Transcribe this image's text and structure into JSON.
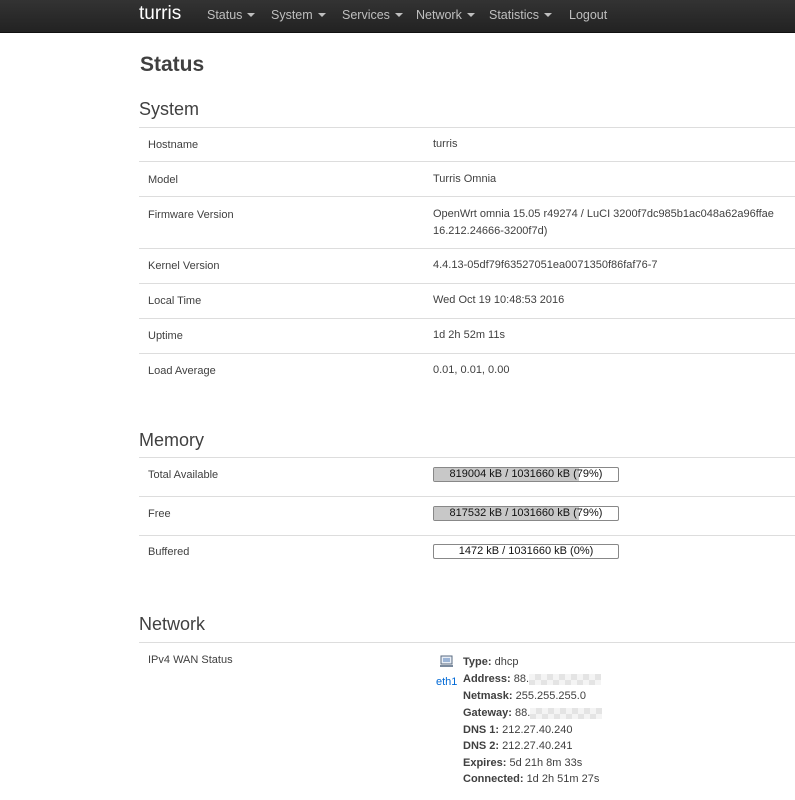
{
  "navbar": {
    "brand": "turris",
    "items": [
      {
        "label": "Status",
        "dropdown": true
      },
      {
        "label": "System",
        "dropdown": true
      },
      {
        "label": "Services",
        "dropdown": true
      },
      {
        "label": "Network",
        "dropdown": true
      },
      {
        "label": "Statistics",
        "dropdown": true
      },
      {
        "label": "Logout",
        "dropdown": false
      }
    ]
  },
  "page": {
    "title": "Status"
  },
  "system": {
    "heading": "System",
    "rows": [
      {
        "label": "Hostname",
        "value": "turris"
      },
      {
        "label": "Model",
        "value": "Turris Omnia"
      },
      {
        "label": "Firmware Version",
        "value": "OpenWrt omnia 15.05 r49274 / LuCI 3200f7dc985b1ac048a62a96ffae",
        "value2": "16.212.24666-3200f7d)"
      },
      {
        "label": "Kernel Version",
        "value": "4.4.13-05df79f63527051ea0071350f86faf76-7"
      },
      {
        "label": "Local Time",
        "value": "Wed Oct 19 10:48:53 2016"
      },
      {
        "label": "Uptime",
        "value": "1d 2h 52m 11s"
      },
      {
        "label": "Load Average",
        "value": "0.01, 0.01, 0.00"
      }
    ]
  },
  "memory": {
    "heading": "Memory",
    "rows": [
      {
        "label": "Total Available",
        "text": "819004 kB / 1031660 kB (79%)",
        "fraction": 0.79
      },
      {
        "label": "Free",
        "text": "817532 kB / 1031660 kB (79%)",
        "fraction": 0.79
      },
      {
        "label": "Buffered",
        "text": "1472 kB / 1031660 kB (0%)",
        "fraction": 0.0
      }
    ]
  },
  "network": {
    "heading": "Network",
    "wan_label": "IPv4 WAN Status",
    "icon": "network-port-icon",
    "interface": "eth1",
    "details": [
      {
        "key": "Type:",
        "value": "dhcp"
      },
      {
        "key": "Address:",
        "value": "88.",
        "redacted": true
      },
      {
        "key": "Netmask:",
        "value": "255.255.255.0"
      },
      {
        "key": "Gateway:",
        "value": "88.",
        "redacted": true
      },
      {
        "key": "DNS 1:",
        "value": "212.27.40.240"
      },
      {
        "key": "DNS 2:",
        "value": "212.27.40.241"
      },
      {
        "key": "Expires:",
        "value": "5d 21h 8m 33s"
      },
      {
        "key": "Connected:",
        "value": "1d 2h 51m 27s"
      }
    ]
  },
  "colors": {
    "navbar": "#222222",
    "link": "#0069d6",
    "bar_fill": "#c8c8c8"
  }
}
